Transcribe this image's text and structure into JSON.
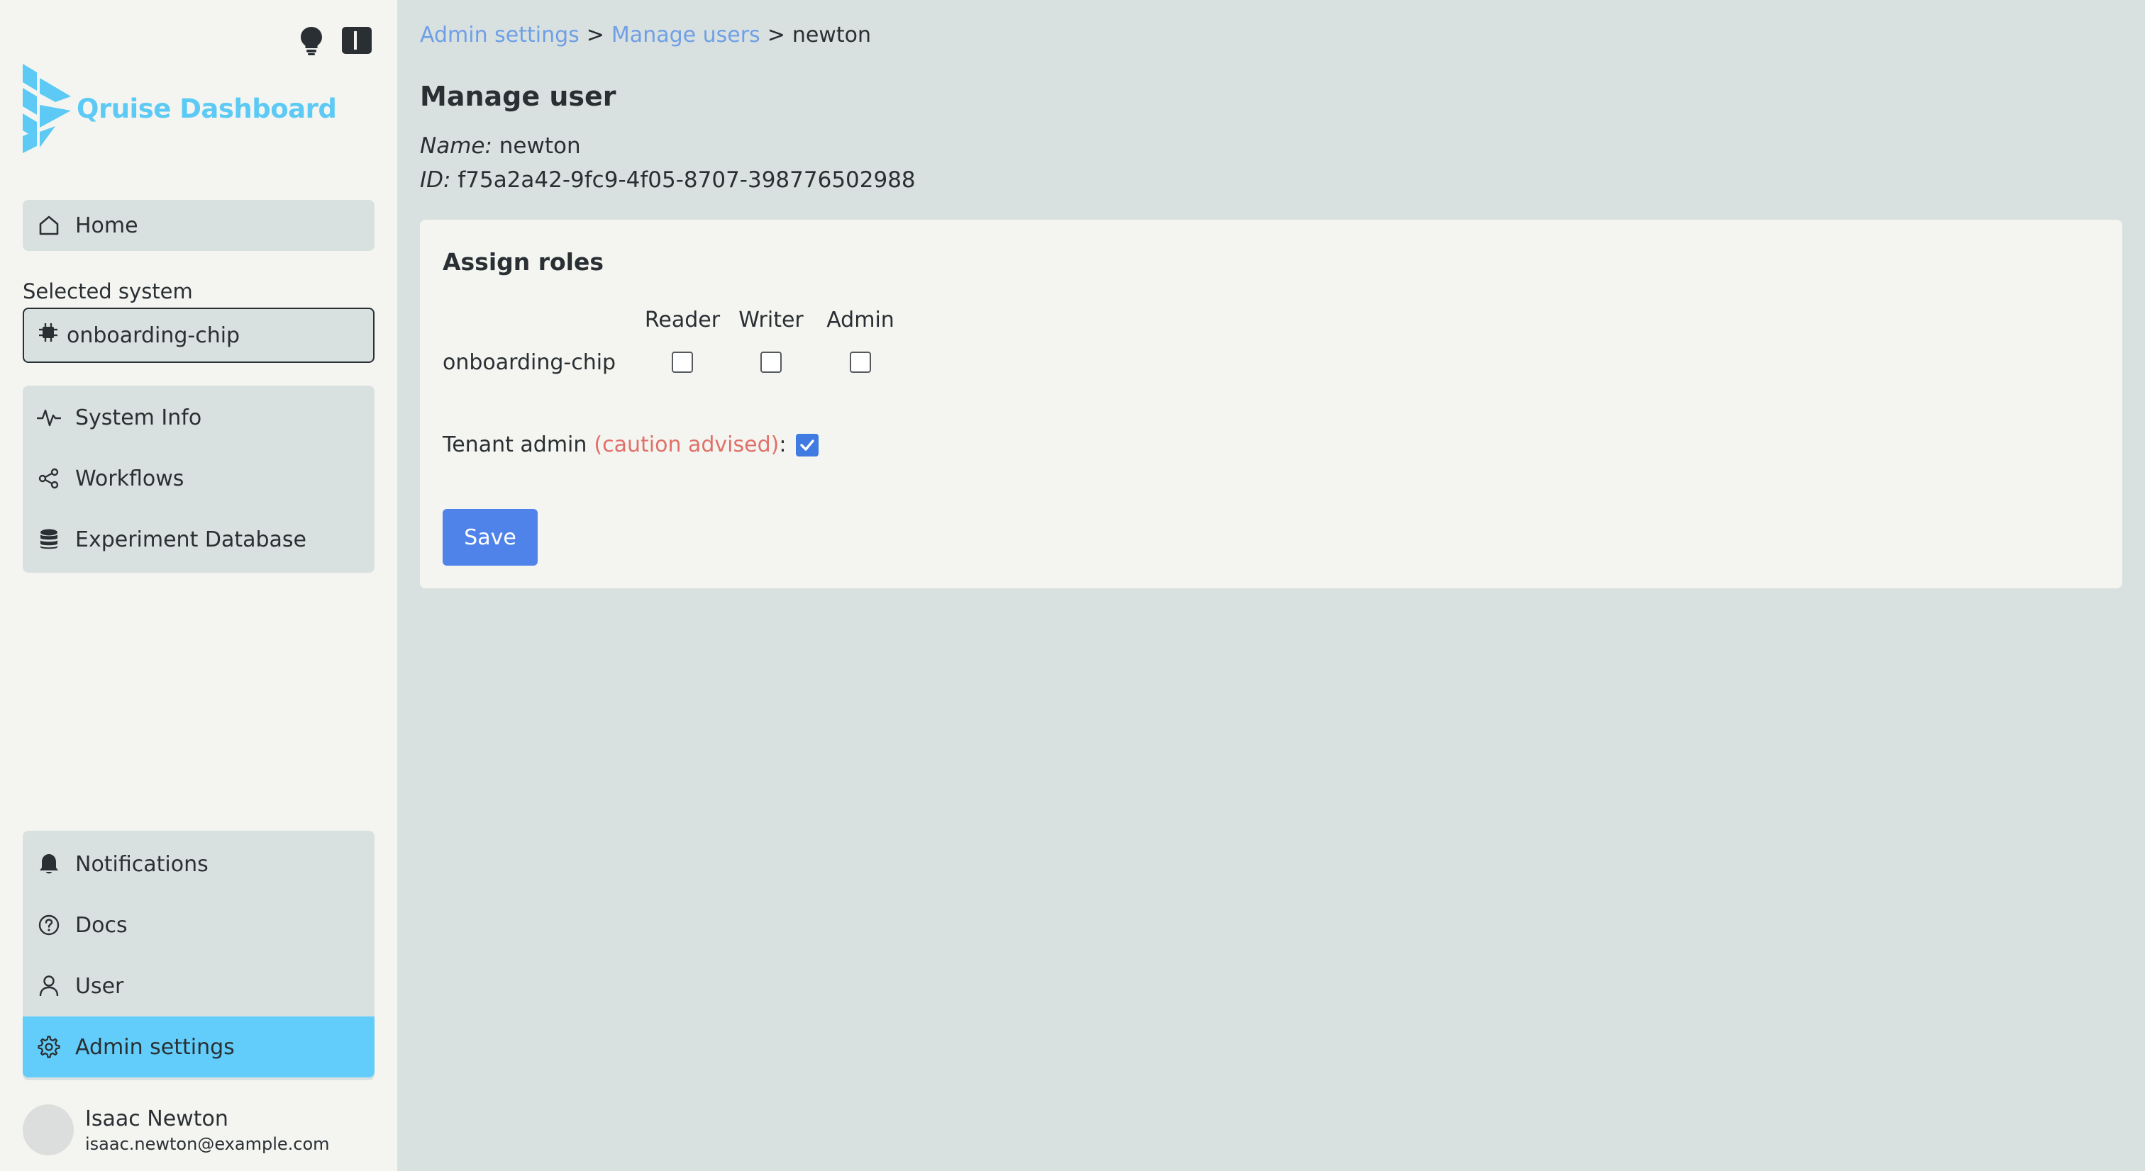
{
  "app": {
    "title": "Qruise Dashboard",
    "brand_color": "#5ccaf4"
  },
  "sidebar": {
    "top_icons": [
      "lightbulb-icon",
      "sidebar-toggle-icon"
    ],
    "home": {
      "label": "Home",
      "icon": "home-icon"
    },
    "selected_system": {
      "label": "Selected system",
      "value": "onboarding-chip",
      "icon": "chip-icon"
    },
    "main_nav": [
      {
        "label": "System Info",
        "icon": "activity-icon"
      },
      {
        "label": "Workflows",
        "icon": "workflow-icon"
      },
      {
        "label": "Experiment Database",
        "icon": "database-icon"
      }
    ],
    "bottom_nav": [
      {
        "label": "Notifications",
        "icon": "bell-icon"
      },
      {
        "label": "Docs",
        "icon": "help-icon"
      },
      {
        "label": "User",
        "icon": "user-icon"
      },
      {
        "label": "Admin settings",
        "icon": "gear-icon",
        "active": true
      }
    ],
    "user": {
      "name": "Isaac Newton",
      "email": "isaac.newton@example.com"
    },
    "active_color": "#62cdfa"
  },
  "main": {
    "breadcrumb": [
      {
        "label": "Admin settings",
        "link": true
      },
      {
        "label": ">",
        "link": false
      },
      {
        "label": "Manage users",
        "link": true
      },
      {
        "label": ">",
        "link": false
      },
      {
        "label": "newton",
        "link": false
      }
    ],
    "title": "Manage user",
    "name_label": "Name:",
    "name_value": "newton",
    "id_label": "ID:",
    "id_value": "f75a2a42-9fc9-4f05-8707-398776502988",
    "card": {
      "title": "Assign roles",
      "role_headers": [
        "Reader",
        "Writer",
        "Admin"
      ],
      "systems": [
        {
          "name": "onboarding-chip",
          "reader": false,
          "writer": false,
          "admin": false
        }
      ],
      "tenant_admin_label": "Tenant admin",
      "tenant_admin_caution": "(caution advised)",
      "tenant_admin_colon": ":",
      "tenant_admin_checked": true,
      "save_label": "Save"
    }
  }
}
